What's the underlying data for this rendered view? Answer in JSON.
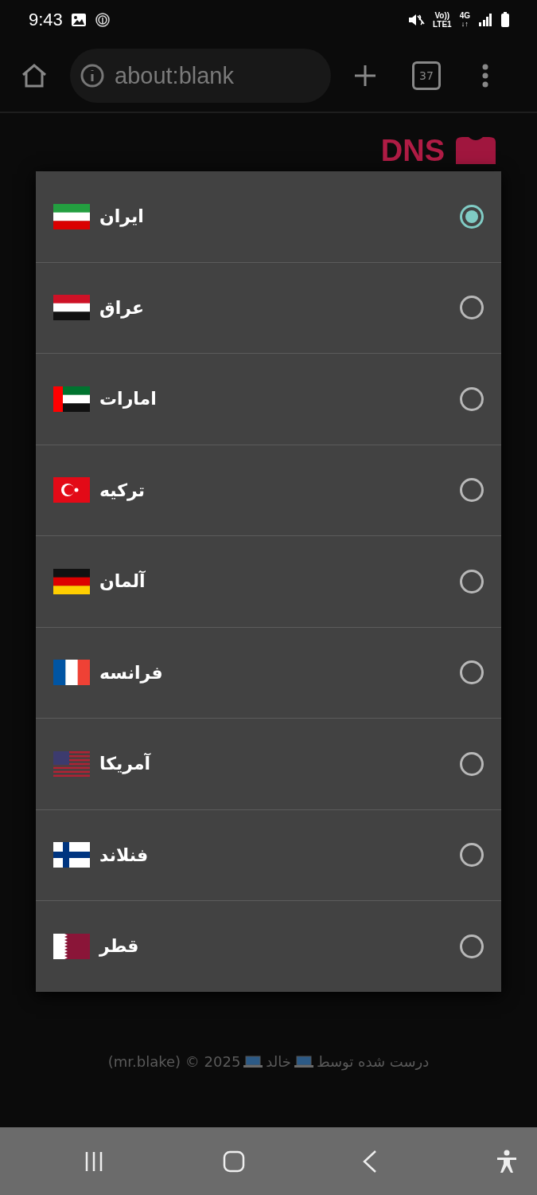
{
  "status_bar": {
    "time": "9:43",
    "volte": "Vo))",
    "lte": "LTE1",
    "network": "4G",
    "data_arrows": "↓↑"
  },
  "browser": {
    "url": "about:blank",
    "tab_count": "37"
  },
  "page": {
    "title_visible": "DNS",
    "footer": {
      "prefix": "درست شده توسط",
      "name": "خالد",
      "suffix": "(mr.blake) © 2025"
    }
  },
  "dialog": {
    "options": [
      {
        "label": "ایران",
        "selected": true
      },
      {
        "label": "عراق",
        "selected": false
      },
      {
        "label": "امارات",
        "selected": false
      },
      {
        "label": "ترکیه",
        "selected": false
      },
      {
        "label": "آلمان",
        "selected": false
      },
      {
        "label": "فرانسه",
        "selected": false
      },
      {
        "label": "آمریکا",
        "selected": false
      },
      {
        "label": "فنلاند",
        "selected": false
      },
      {
        "label": "قطر",
        "selected": false
      }
    ]
  }
}
